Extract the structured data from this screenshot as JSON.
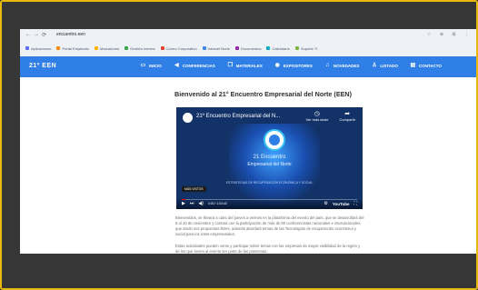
{
  "browser": {
    "nav": [
      "←",
      "→",
      "⟳"
    ],
    "url": "encuentro.een",
    "actions": "☆ ⊕ ⊞ ⋮",
    "bookmarks": [
      {
        "label": "Aplicaciones",
        "color": "#5b6cff"
      },
      {
        "label": "Portal Empleado",
        "color": "#ff8a00"
      },
      {
        "label": "Marcadores",
        "color": "#ffb300"
      },
      {
        "label": "Gestión Interna",
        "color": "#34a853"
      },
      {
        "label": "Correo Corporativo",
        "color": "#ea4335"
      },
      {
        "label": "Intranet Norte",
        "color": "#4285f4"
      },
      {
        "label": "Documentos",
        "color": "#9c27b0"
      },
      {
        "label": "Calendario",
        "color": "#00acc1"
      },
      {
        "label": "Soporte TI",
        "color": "#7cb342"
      }
    ]
  },
  "site": {
    "logo": "21º EEN",
    "menu": [
      {
        "label": "INICIO",
        "icon": "monitor-icon",
        "glyph": "▭"
      },
      {
        "label": "CONFERENCIAS",
        "icon": "megaphone-icon",
        "glyph": "◀"
      },
      {
        "label": "MATERIALES",
        "icon": "folder-icon",
        "glyph": "❐"
      },
      {
        "label": "EXPOSITORES",
        "icon": "globe-icon",
        "glyph": "◉"
      },
      {
        "label": "NOVEDADES",
        "icon": "bell-icon",
        "glyph": "♫"
      },
      {
        "label": "LISTADO",
        "icon": "user-icon",
        "glyph": "♙"
      },
      {
        "label": "CONTACTO",
        "icon": "calendar-icon",
        "glyph": "▤"
      }
    ]
  },
  "page": {
    "title": "Bienvenido al 21° Encuentro Empresarial del Norte (EEN)"
  },
  "video": {
    "title": "21º Encuentro Empresarial del N...",
    "watch_later": "Ver más tarde",
    "share": "Compartir",
    "event_number": "21 Encuentro",
    "event_name": "Empresarial del Norte",
    "event_subtitle": "ESTRATEGIAS DE RECUPERACIÓN ECONÓMICA Y SOCIAL",
    "badge": "MÁS VISTOS",
    "time": "0:00 / 1:03:40",
    "progress": 0.02,
    "youtube": "YouTube",
    "progress_color": "#ff0000"
  },
  "body": {
    "paragraph1": "Bienvenidos, se llevará a cabo del jueves a viernes en la plataforma del evento del país, que se desarrollará del 8 al 10 de noviembre y contará con la participación de más de 80 conferencistas nacionales e internacionales, que darán sus propuestas libres, además abordará temas de las Tecnologías de recuperación económica y social para los retos empresariales.",
    "paragraph2": "Estas actividades pueden verse y participar sobre temas con las empresas de mayor visibilidad de la región y de los que tienen al evento ser parte de las ponencias."
  }
}
